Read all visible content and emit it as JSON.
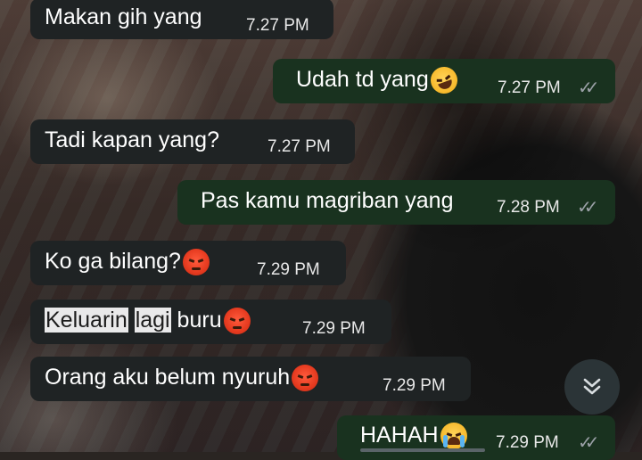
{
  "messages": [
    {
      "dir": "in",
      "text": "Makan gih yang",
      "time": "7.27 PM"
    },
    {
      "dir": "out",
      "text": "Udah td yang",
      "emoji": "rolling-laughing-emoji",
      "time": "7.27 PM",
      "status": "read"
    },
    {
      "dir": "in",
      "text": "Tadi kapan yang?",
      "time": "7.27 PM"
    },
    {
      "dir": "out",
      "text": "Pas kamu magriban yang",
      "time": "7.28 PM",
      "status": "read"
    },
    {
      "dir": "in",
      "text": "Ko ga bilang?",
      "emoji": "angry-emoji",
      "time": "7.29 PM"
    },
    {
      "dir": "in",
      "text_parts": [
        "Keluarin",
        " ",
        "lagi",
        " buru"
      ],
      "emoji": "angry-emoji",
      "time": "7.29 PM",
      "selected_words": [
        "Keluarin",
        "lagi"
      ]
    },
    {
      "dir": "in",
      "text": "Orang aku belum nyuruh",
      "emoji": "angry-emoji",
      "time": "7.29 PM"
    },
    {
      "dir": "out",
      "text": "HAHAH",
      "emoji": "crying-emoji",
      "time": "7.29 PM",
      "status": "read"
    }
  ],
  "scroll_button_icon": "chevron-double-down-icon",
  "colors": {
    "incoming": "#1f2324",
    "outgoing": "#19321f",
    "text": "#ffffff",
    "time": "#e8e8e8",
    "ticks": "#9aa0a6"
  }
}
